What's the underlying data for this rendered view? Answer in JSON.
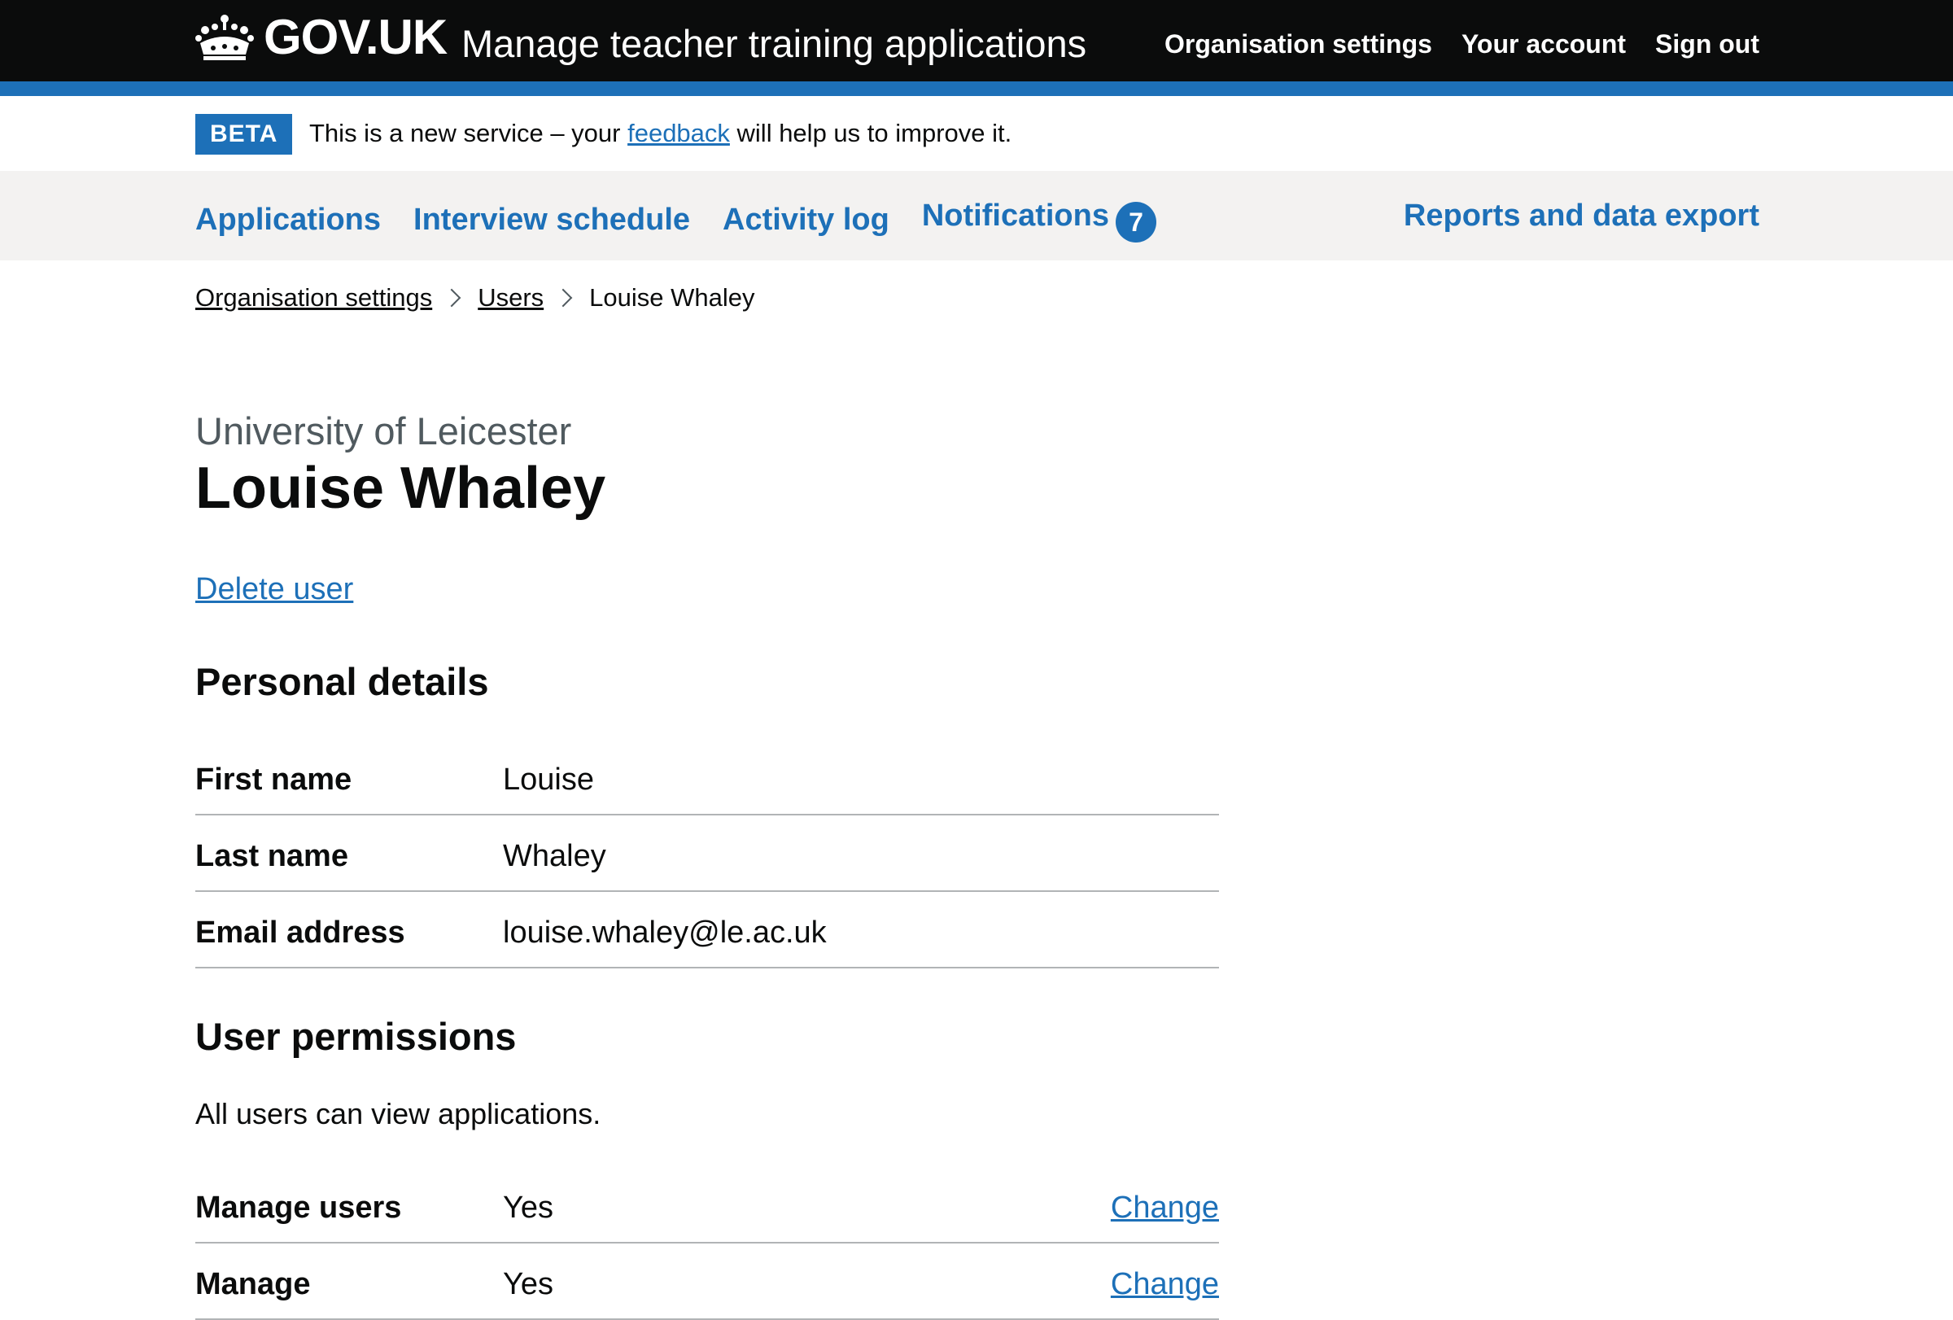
{
  "header": {
    "logo_text": "GOV.UK",
    "service_name": "Manage teacher training applications",
    "nav": [
      "Organisation settings",
      "Your account",
      "Sign out"
    ]
  },
  "phase_banner": {
    "tag": "BETA",
    "text_before": "This is a new service – your ",
    "link": "feedback",
    "text_after": " will help us to improve it."
  },
  "primary_nav": {
    "items": [
      "Applications",
      "Interview schedule",
      "Activity log",
      "Notifications"
    ],
    "notifications_count": "7",
    "right_item": "Reports and data export"
  },
  "breadcrumbs": {
    "items": [
      "Organisation settings",
      "Users"
    ],
    "current": "Louise Whaley"
  },
  "page": {
    "caption": "University of Leicester",
    "title": "Louise Whaley",
    "delete_link": "Delete user"
  },
  "personal_details": {
    "heading": "Personal details",
    "rows": [
      {
        "key": "First name",
        "value": "Louise"
      },
      {
        "key": "Last name",
        "value": "Whaley"
      },
      {
        "key": "Email address",
        "value": "louise.whaley@le.ac.uk"
      }
    ]
  },
  "user_permissions": {
    "heading": "User permissions",
    "intro": "All users can view applications.",
    "rows": [
      {
        "key": "Manage users",
        "value": "Yes",
        "action": "Change"
      },
      {
        "key": "Manage",
        "value": "Yes",
        "action": "Change"
      }
    ]
  },
  "colors": {
    "header_bg": "#0b0c0c",
    "brand_blue": "#1d70b8",
    "nav_bg": "#f3f2f1",
    "secondary_text": "#505a5f",
    "border": "#b1b4b6"
  }
}
